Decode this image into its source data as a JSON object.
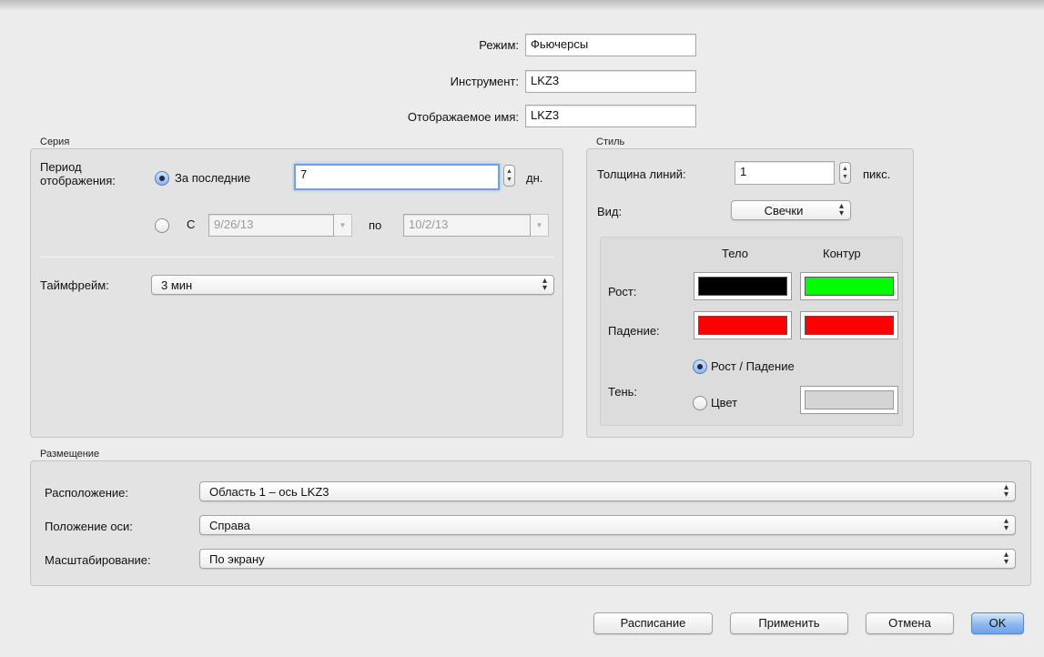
{
  "header": {
    "mode_label": "Режим:",
    "mode_value": "Фьючерсы",
    "instrument_label": "Инструмент:",
    "instrument_value": "LKZ3",
    "display_name_label": "Отображаемое имя:",
    "display_name_value": "LKZ3"
  },
  "series": {
    "title": "Серия",
    "period_label_line1": "Период",
    "period_label_line2": "отображения:",
    "last_option": "За последние",
    "last_value": "7",
    "last_unit": "дн.",
    "range_option": "С",
    "range_from": "9/26/13",
    "range_to_label": "по",
    "range_to": "10/2/13",
    "timeframe_label": "Таймфрейм:",
    "timeframe_value": "3 мин"
  },
  "style": {
    "title": "Стиль",
    "line_width_label": "Толщина линий:",
    "line_width_value": "1",
    "line_width_unit": "пикс.",
    "view_label": "Вид:",
    "view_value": "Свечки",
    "body_header": "Тело",
    "outline_header": "Контур",
    "up_label": "Рост:",
    "down_label": "Падение:",
    "shadow_label": "Тень:",
    "shadow_option_updown": "Рост / Падение",
    "shadow_option_color": "Цвет",
    "colors": {
      "up_body": "#000000",
      "up_outline": "#00ff00",
      "down_body": "#ff0000",
      "down_outline": "#ff0000",
      "shadow": "#d4d4d4"
    }
  },
  "placement": {
    "title": "Размещение",
    "location_label": "Расположение:",
    "location_value": "Область 1 – ось LKZ3",
    "axis_position_label": "Положение оси:",
    "axis_position_value": "Справа",
    "scaling_label": "Масштабирование:",
    "scaling_value": "По экрану"
  },
  "buttons": {
    "schedule": "Расписание",
    "apply": "Применить",
    "cancel": "Отмена",
    "ok": "OK"
  },
  "icons": {
    "popup_arrows": "updown-chevron-icon",
    "stepper": "stepper-icon",
    "dropdown": "chevron-down-icon"
  }
}
